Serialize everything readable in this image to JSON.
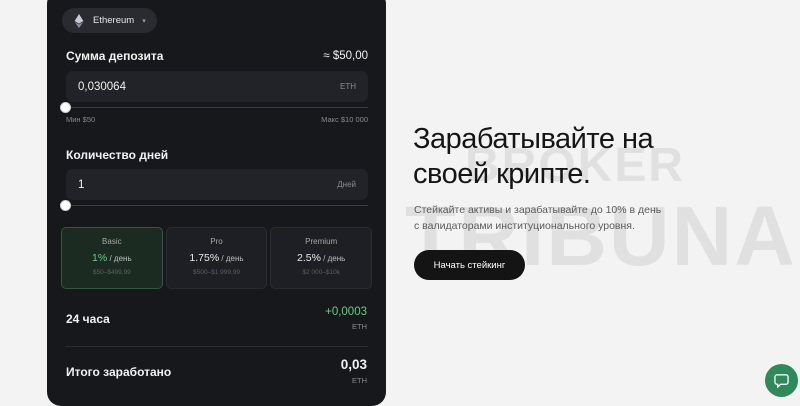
{
  "watermark": {
    "line1": "BROKER",
    "line2": "TRIBUNAL"
  },
  "calculator": {
    "token": {
      "label": "Ethereum",
      "icon": "ethereum-icon"
    },
    "deposit": {
      "label": "Сумма депозита",
      "usd_value": "≈ $50,00",
      "value": "0,030064",
      "unit": "ETH",
      "min_label": "Мин $50",
      "max_label": "Макс $10 000",
      "slider_level": 0
    },
    "days": {
      "label": "Количество дней",
      "value": "1",
      "unit": "Дней",
      "slider_level": 0
    },
    "plans": [
      {
        "name": "Basic",
        "rate": "1%",
        "per": " / день",
        "range": "$50–$499,99",
        "active": true
      },
      {
        "name": "Pro",
        "rate": "1.75%",
        "per": " / день",
        "range": "$500–$1 999,99",
        "active": false
      },
      {
        "name": "Premium",
        "rate": "2.5%",
        "per": " / день",
        "range": "$2 000–$10k",
        "active": false
      }
    ],
    "profit": {
      "label": "24 часа",
      "value": "+0,0003",
      "unit": "ETH"
    },
    "total": {
      "label": "Итого заработано",
      "value": "0,03",
      "unit": "ETH"
    }
  },
  "hero": {
    "title": "Зарабатывайте на своей крипте.",
    "description": "Стейкайте активы и зарабатывайте до 10% в день с валидаторами институционального уровня.",
    "cta": "Начать стейкинг"
  },
  "chat": {
    "icon": "chat-icon"
  },
  "colors": {
    "accent_green": "#5fd07e",
    "card_bg": "#17181c",
    "chat_bg": "#2f8a5b"
  }
}
